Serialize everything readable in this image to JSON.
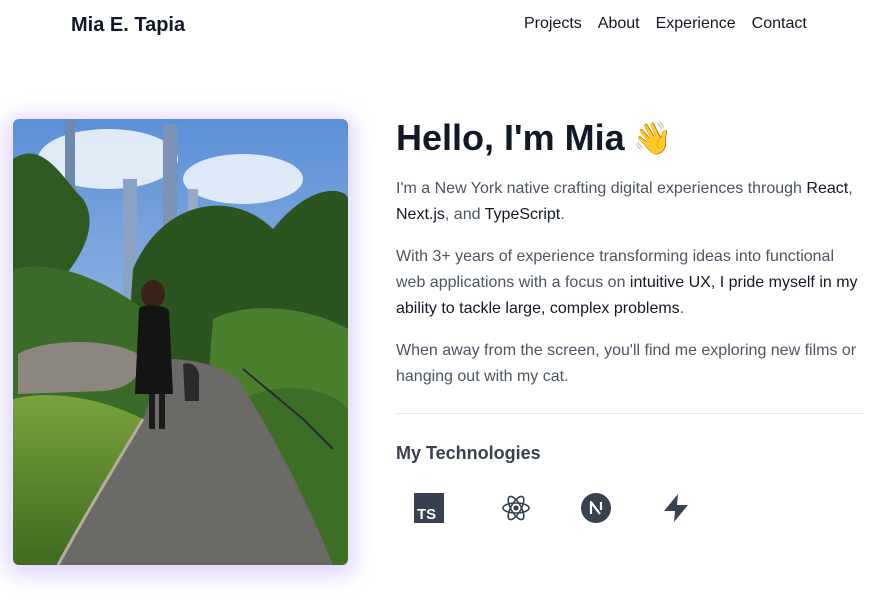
{
  "header": {
    "brand": "Mia E. Tapia",
    "nav": [
      "Projects",
      "About",
      "Experience",
      "Contact"
    ]
  },
  "hero": {
    "title": "Hello, I'm Mia",
    "emoji": "👋",
    "p1": {
      "a": "I'm a New York native crafting digital experiences through ",
      "react": "React",
      "b": ", ",
      "next": "Next.js",
      "c": ", and ",
      "ts": "TypeScript",
      "d": "."
    },
    "p2": {
      "a": "With 3+ years of experience transforming ideas into functional web applications with a focus on ",
      "hl": "intuitive UX, I pride myself in my ability to tackle large, complex problems",
      "b": "."
    },
    "p3": "When away from the screen, you'll find me exploring new films or hanging out with my cat."
  },
  "technologies": {
    "title": "My Technologies",
    "icons": [
      "typescript-icon",
      "react-icon",
      "nextjs-icon",
      "supabase-icon"
    ]
  },
  "photo": {
    "icon": "portrait-photo-park-path"
  },
  "colors": {
    "text": "#111827",
    "muted": "#4b5563",
    "icon": "#374151",
    "glow": "#8b5cf6"
  }
}
